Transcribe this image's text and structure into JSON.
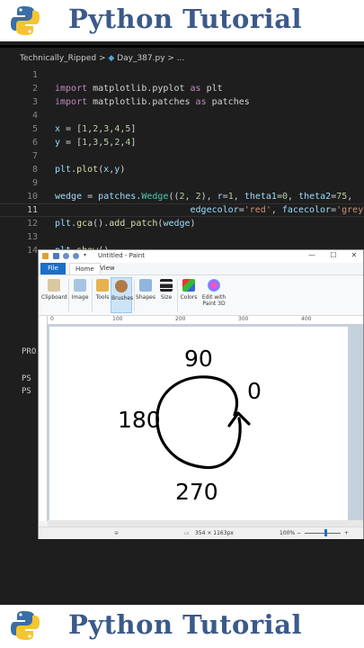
{
  "banner": {
    "title": "Python Tutorial"
  },
  "breadcrumb": {
    "folder": "Technically_Ripped",
    "sep": ">",
    "file": "Day_387.py",
    "tail": "> ..."
  },
  "code": {
    "line_numbers": [
      "1",
      "2",
      "3",
      "4",
      "5",
      "6",
      "7",
      "8",
      "9",
      "10",
      "11",
      "12",
      "13",
      "14"
    ],
    "current_line": "11",
    "lines": [
      "",
      "import matplotlib.pyplot as plt",
      "import matplotlib.patches as patches",
      "",
      "x = [1,2,3,4,5]",
      "y = [1,3,5,2,4]",
      "",
      "plt.plot(x,y)",
      "",
      "wedge = patches.Wedge((2, 2), r=1, theta1=0, theta2=75,",
      "                         edgecolor='red', facecolor='grey')",
      "plt.gca().add_patch(wedge)",
      "",
      "plt.show()"
    ]
  },
  "terminal": {
    "header": "PRO",
    "prompt1": "PS",
    "prompt2": "PS"
  },
  "paint": {
    "window_title": "Untitled - Paint",
    "window_buttons": [
      "—",
      "☐",
      "✕"
    ],
    "menu": {
      "file": "File",
      "home": "Home",
      "view": "View"
    },
    "ribbon": [
      "Clipboard",
      "Image",
      "Tools",
      "Brushes",
      "Shapes",
      "Size",
      "Colors",
      "Edit with Paint 3D"
    ],
    "ruler": [
      "0",
      "100",
      "200",
      "300",
      "400"
    ],
    "status": {
      "dimensions": "354 × 1163px",
      "zoom": "100%"
    },
    "drawing": {
      "label_top": "90",
      "label_right": "0",
      "label_left": "180",
      "label_bottom": "270"
    }
  },
  "colors": {
    "banner_title": "#3b5a8a",
    "keyword": "#c586c0",
    "variable": "#9cdcfe",
    "function": "#dcdcaa",
    "number": "#b5cea8",
    "string": "#ce9178",
    "class": "#4ec9b0"
  }
}
